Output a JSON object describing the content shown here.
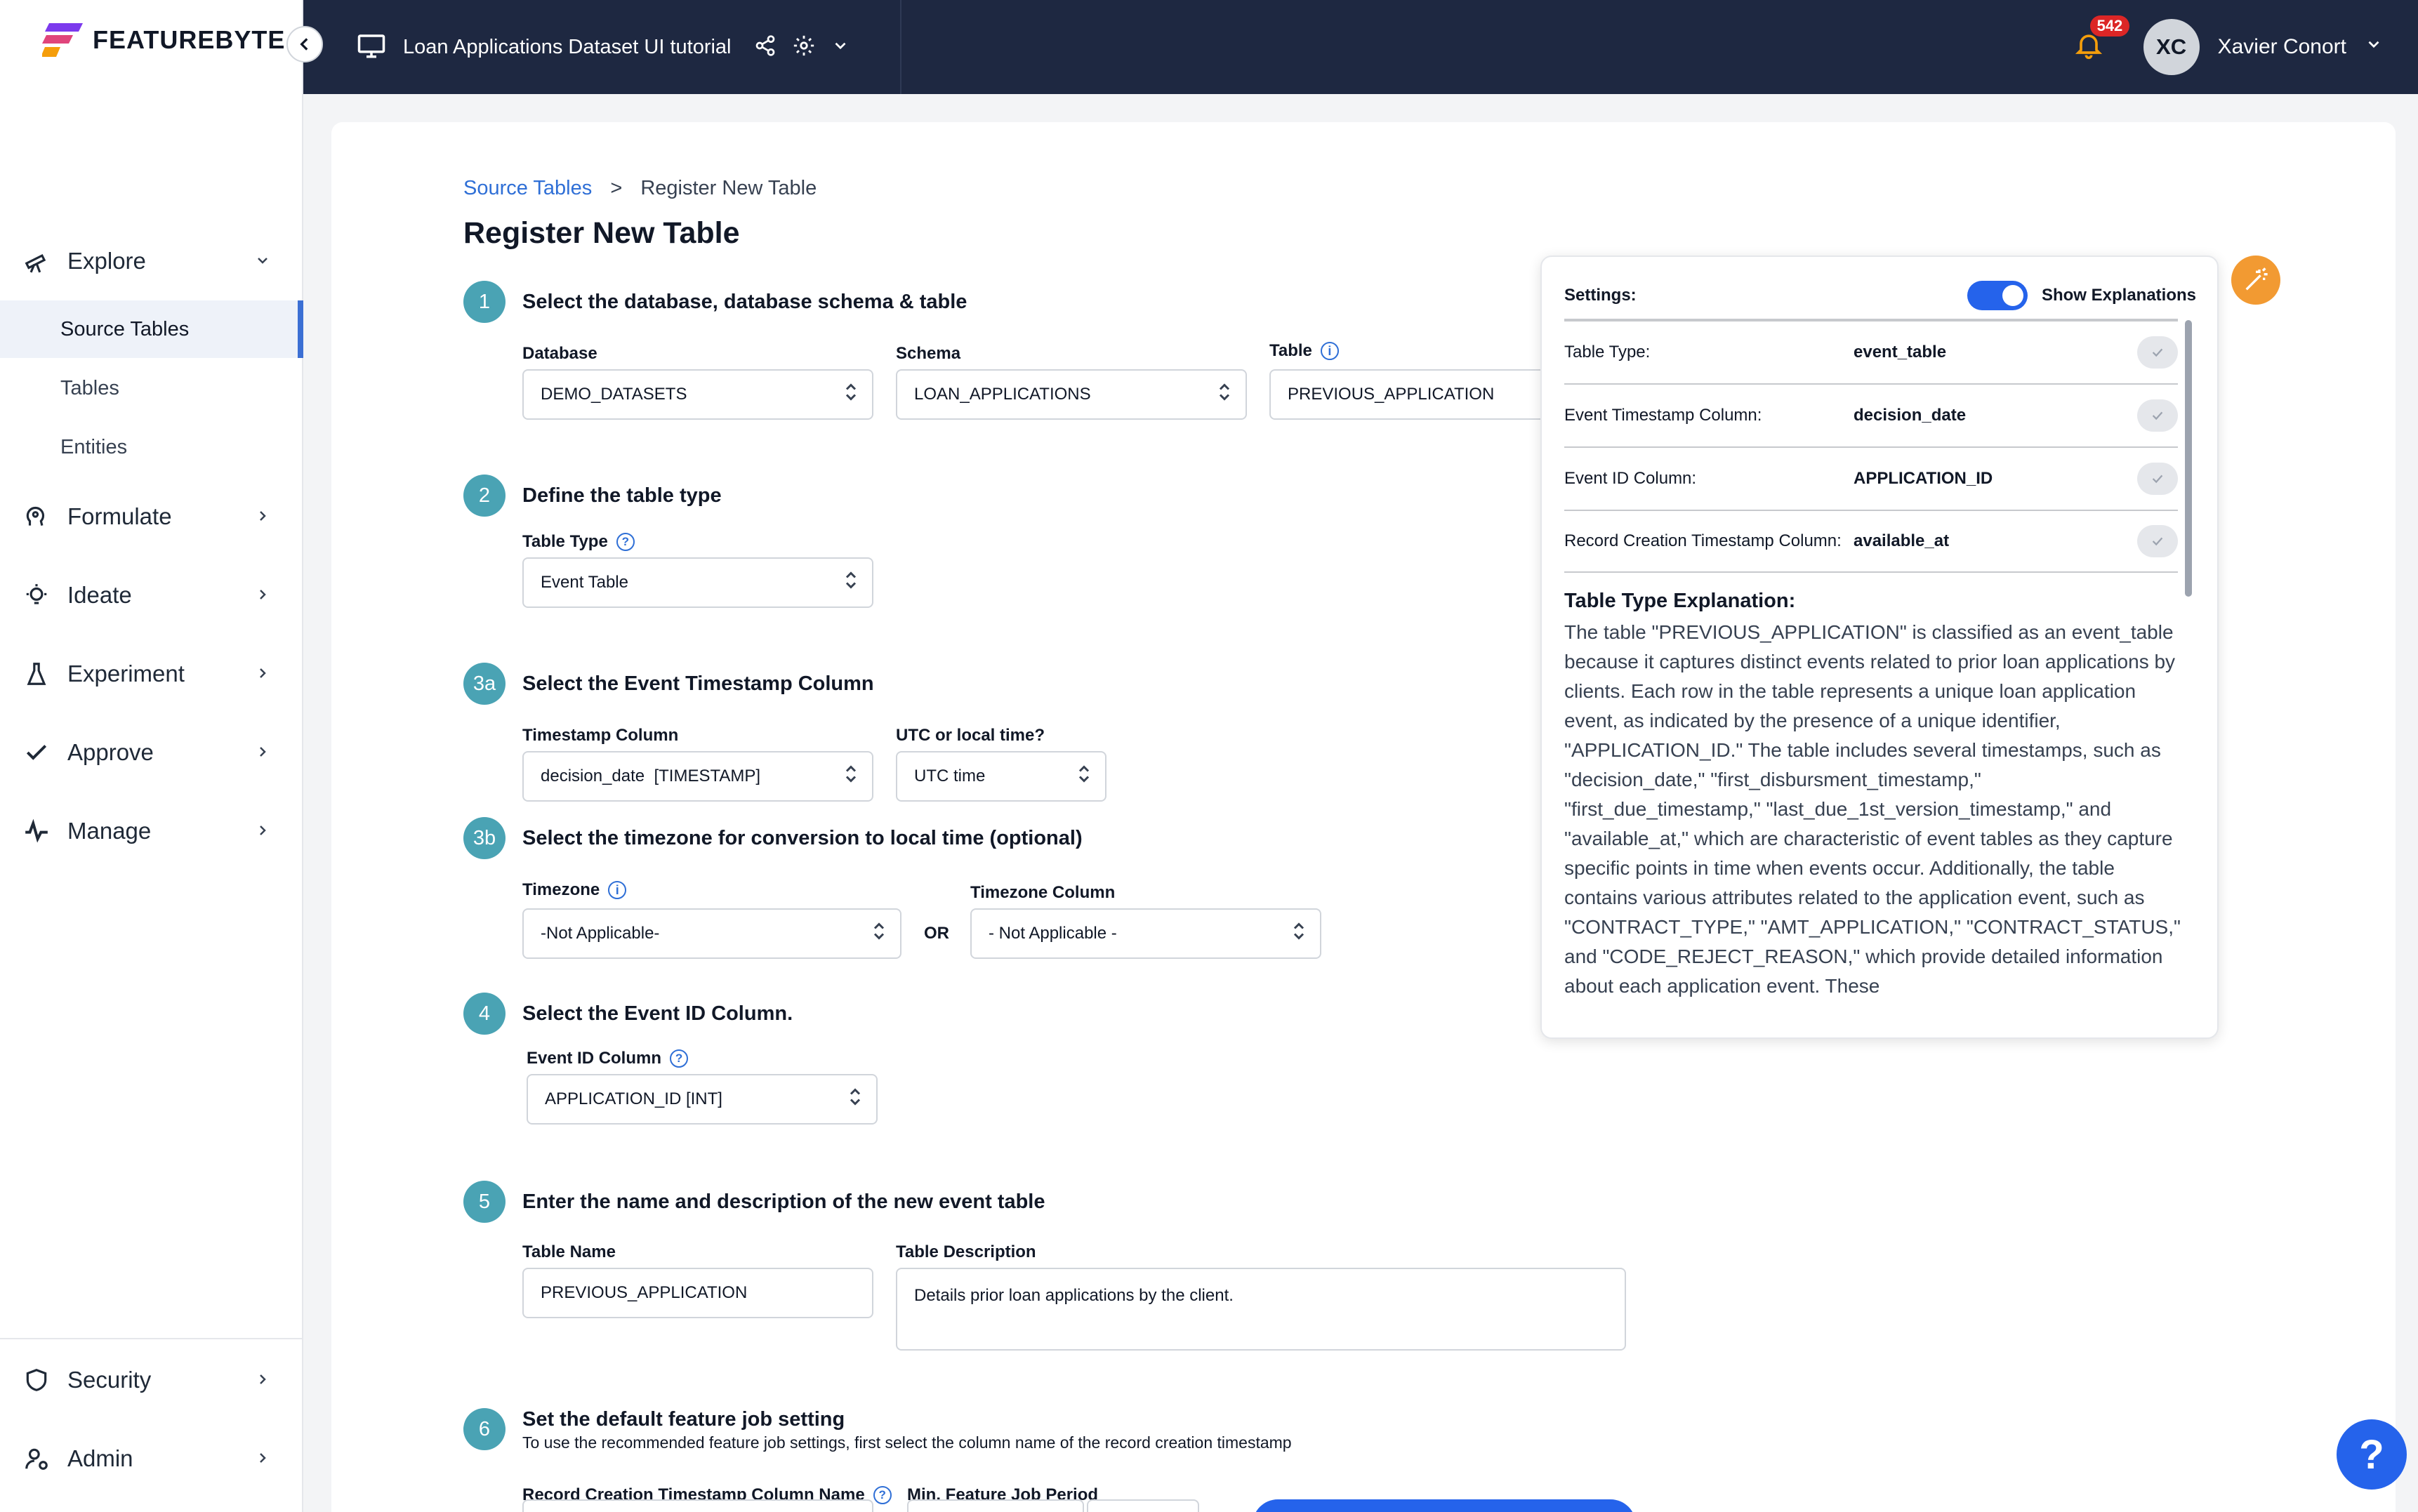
{
  "app": {
    "logo_text": "FEATUREBYTE"
  },
  "topbar": {
    "project_title": "Loan Applications Dataset UI tutorial",
    "notifications_count": "542",
    "user_initials": "XC",
    "user_name": "Xavier Conort"
  },
  "sidebar": {
    "explore": "Explore",
    "explore_sub": [
      "Source Tables",
      "Tables",
      "Entities"
    ],
    "formulate": "Formulate",
    "ideate": "Ideate",
    "experiment": "Experiment",
    "approve": "Approve",
    "manage": "Manage",
    "security": "Security",
    "admin": "Admin"
  },
  "breadcrumb": {
    "root": "Source Tables",
    "sep": ">",
    "current": "Register New Table"
  },
  "page_title": "Register New Table",
  "steps": {
    "s1": {
      "num": "1",
      "title": "Select the database, database schema & table",
      "database_label": "Database",
      "database_value": "DEMO_DATASETS",
      "schema_label": "Schema",
      "schema_value": "LOAN_APPLICATIONS",
      "table_label": "Table",
      "table_value": "PREVIOUS_APPLICATION"
    },
    "s2": {
      "num": "2",
      "title": "Define the table type",
      "type_label": "Table Type",
      "type_value": "Event Table"
    },
    "s3a": {
      "num": "3a",
      "title": "Select the Event Timestamp Column",
      "ts_label": "Timestamp Column",
      "ts_value": "decision_date  [TIMESTAMP]",
      "utc_label": "UTC or local time?",
      "utc_value": "UTC time"
    },
    "s3b": {
      "num": "3b",
      "title": "Select the timezone for conversion to local time (optional)",
      "tz_label": "Timezone",
      "tz_value": "-Not Applicable-",
      "or": "OR",
      "tzcol_label": "Timezone Column",
      "tzcol_value": "- Not Applicable -"
    },
    "s4": {
      "num": "4",
      "title": "Select the Event ID Column.",
      "id_label": "Event ID Column",
      "id_value": "APPLICATION_ID [INT]"
    },
    "s5": {
      "num": "5",
      "title": "Enter the name and description of the new event table",
      "name_label": "Table Name",
      "name_value": "PREVIOUS_APPLICATION",
      "desc_label": "Table Description",
      "desc_value": "Details prior loan applications by the client."
    },
    "s6": {
      "num": "6",
      "title": "Set the default feature job setting",
      "subtitle": "To use the recommended feature job settings, first select the column name of the record creation timestamp",
      "rc_label": "Record Creation Timestamp Column Name",
      "period_label": "Min. Feature Job Period"
    }
  },
  "settings_panel": {
    "title": "Settings:",
    "toggle_label": "Show Explanations",
    "toggle_on": true,
    "rows": [
      {
        "key": "Table Type:",
        "value": "event_table"
      },
      {
        "key": "Event Timestamp Column:",
        "value": "decision_date"
      },
      {
        "key": "Event ID Column:",
        "value": "APPLICATION_ID"
      },
      {
        "key": "Record Creation Timestamp Column:",
        "value": "available_at"
      }
    ],
    "explanation_title": "Table Type Explanation:",
    "explanation_text": "The table \"PREVIOUS_APPLICATION\" is classified as an event_table because it captures distinct events related to prior loan applications by clients. Each row in the table represents a unique loan application event, as indicated by the presence of a unique identifier, \"APPLICATION_ID.\" The table includes several timestamps, such as \"decision_date,\" \"first_disbursment_timestamp,\" \"first_due_timestamp,\" \"last_due_1st_version_timestamp,\" and \"available_at,\" which are characteristic of event tables as they capture specific points in time when events occur. Additionally, the table contains various attributes related to the application event, such as \"CONTRACT_TYPE,\" \"AMT_APPLICATION,\" \"CONTRACT_STATUS,\" and \"CODE_REJECT_REASON,\" which provide detailed information about each application event. These"
  },
  "help_button": "?",
  "colors": {
    "accent": "#2563eb",
    "step": "#4aa3b4",
    "topbar": "#1e2841",
    "link": "#2f6fd6",
    "magic": "#f29a32"
  }
}
